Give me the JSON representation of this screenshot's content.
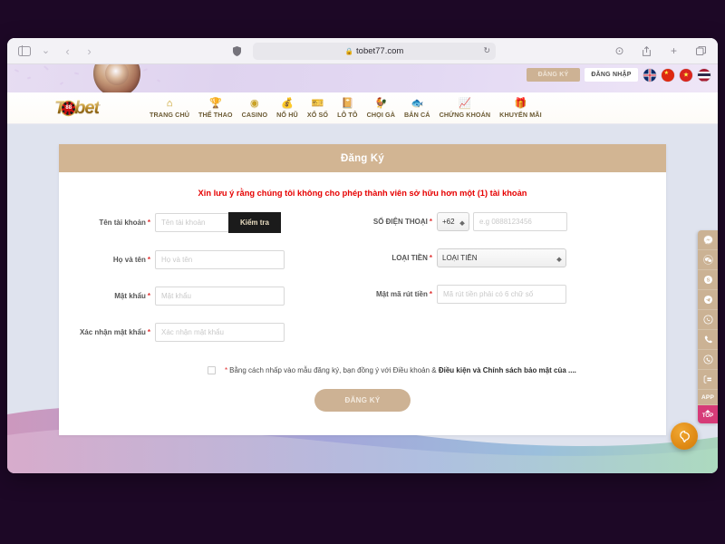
{
  "browser": {
    "url": "tobet77.com",
    "lock_glyph": "🔒",
    "reload_glyph": "↻",
    "back_glyph": "‹",
    "forward_glyph": "›",
    "sidebar_chevron": "⌄",
    "download_glyph": "⊙",
    "share_glyph": "⇧",
    "newtab_glyph": "+",
    "tabs_glyph": "❐"
  },
  "header": {
    "register_label": "ĐĂNG KÝ",
    "login_label": "ĐĂNG NHẬP",
    "flags": [
      {
        "name": "flag-uk",
        "code": "UK"
      },
      {
        "name": "flag-cn",
        "code": "CN"
      },
      {
        "name": "flag-vn",
        "code": "VN"
      },
      {
        "name": "flag-th",
        "code": "TH"
      }
    ],
    "logo": {
      "text_left": "T",
      "badge": "88",
      "text_right": "bet"
    }
  },
  "nav": {
    "items": [
      {
        "label": "TRANG CHỦ",
        "icon": "home-icon",
        "glyph": "⌂"
      },
      {
        "label": "THỂ THAO",
        "icon": "trophy-icon",
        "glyph": "🏆"
      },
      {
        "label": "CASINO",
        "icon": "casino-chip-icon",
        "glyph": "◉"
      },
      {
        "label": "NỔ HŨ",
        "icon": "slot-money-icon",
        "glyph": "💰"
      },
      {
        "label": "XỔ SỐ",
        "icon": "lottery-icon",
        "glyph": "🎫"
      },
      {
        "label": "LÔ TÔ",
        "icon": "loto-card-icon",
        "glyph": "📔"
      },
      {
        "label": "CHỌI GÀ",
        "icon": "rooster-icon",
        "glyph": "🐓"
      },
      {
        "label": "BẮN CÁ",
        "icon": "fish-icon",
        "glyph": "🐟"
      },
      {
        "label": "CHỨNG KHOÁN",
        "icon": "stock-chart-icon",
        "glyph": "📈"
      },
      {
        "label": "KHUYẾN MÃI",
        "icon": "gift-icon",
        "glyph": "🎁"
      }
    ]
  },
  "registration": {
    "title": "Đăng Ký",
    "notice": "Xin lưu ý rằng chúng tôi không cho phép thành viên sở hữu hơn một (1) tài khoản",
    "fields_left": [
      {
        "label": "Tên tài khoản",
        "placeholder": "Tên tài khoản",
        "value": "",
        "required": true
      },
      {
        "label": "Họ và tên",
        "placeholder": "Họ và tên",
        "value": "",
        "required": true
      },
      {
        "label": "Mật khẩu",
        "placeholder": "Mật khẩu",
        "value": "",
        "required": true
      },
      {
        "label": "Xác nhận mật khẩu",
        "placeholder": "Xác nhận mật khẩu",
        "value": "",
        "required": true
      }
    ],
    "check_button": "Kiểm tra",
    "fields_right": [
      {
        "label": "SỐ ĐIỆN THOẠI",
        "placeholder": "e.g 0888123456",
        "value": "",
        "required": true
      },
      {
        "label": "LOẠI TIỀN",
        "placeholder": "",
        "value": "LOẠI TIỀN",
        "required": true
      },
      {
        "label": "Mật mã rút tiền",
        "placeholder": "Mã rút tiền phải có 6 chữ số",
        "value": "",
        "required": true
      }
    ],
    "country_code": "+62",
    "currency_selected": "LOẠI TIỀN",
    "terms": {
      "bullet": "*",
      "text_before": "Bằng cách nhấp vào mẫu đăng ký, bạn đồng ý với Điều khoản & ",
      "text_bold": "Điều kiện và Chính sách bảo mật của ....",
      "checked": false
    },
    "submit_label": "ĐĂNG KÝ"
  },
  "right_rail": {
    "items": [
      {
        "name": "messenger-icon",
        "glyph": "✉"
      },
      {
        "name": "wechat-icon",
        "glyph": "💬"
      },
      {
        "name": "skype-icon",
        "glyph": "S"
      },
      {
        "name": "telegram-icon",
        "glyph": "➤"
      },
      {
        "name": "whatsapp-icon",
        "glyph": "✆"
      },
      {
        "name": "phone-icon",
        "glyph": "☎"
      },
      {
        "name": "viber-icon",
        "glyph": "✆"
      },
      {
        "name": "qr-code-icon",
        "glyph": "▦"
      }
    ],
    "app_label": "APP",
    "top_label": "TOP"
  },
  "chat": {
    "icon": "chat-bubble-icon"
  },
  "colors": {
    "brand_tan": "#d2b593",
    "notice_red": "#e60000",
    "rail_tan": "#cbb294",
    "rail_top_pink": "#d63b78",
    "chat_orange": "#e08a14",
    "check_button_dark": "#1b1b1b"
  }
}
